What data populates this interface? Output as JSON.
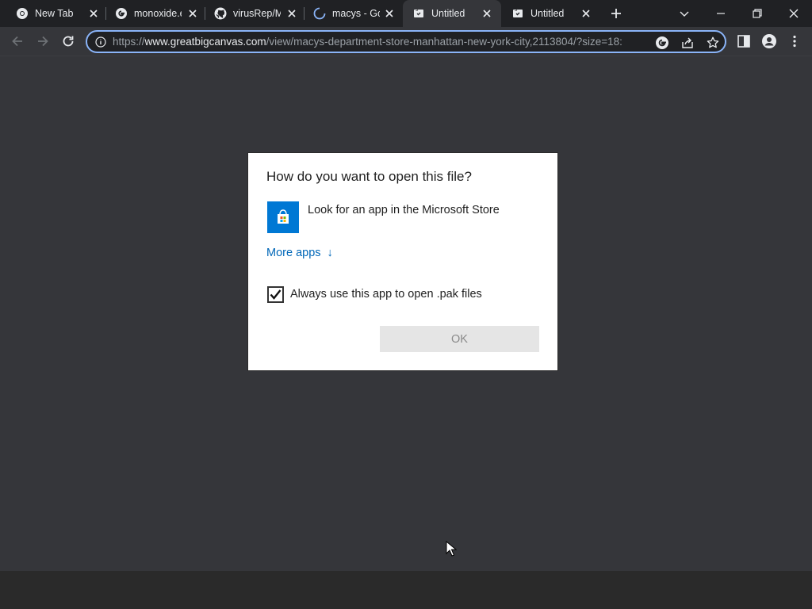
{
  "tabs": [
    {
      "title": "New Tab",
      "icon": "chrome-icon"
    },
    {
      "title": "monoxide.e",
      "icon": "google-icon"
    },
    {
      "title": "virusRep/M",
      "icon": "github-icon"
    },
    {
      "title": "macys - Go",
      "icon": "loading-spinner-icon"
    },
    {
      "title": "Untitled",
      "icon": "page-icon",
      "active": true
    },
    {
      "title": "Untitled",
      "icon": "page-icon"
    }
  ],
  "omnibox": {
    "scheme": "https://",
    "host": "www.greatbigcanvas.com",
    "path": "/view/macys-department-store-manhattan-new-york-city,2113804/?size=18:"
  },
  "dialog": {
    "title": "How do you want to open this file?",
    "store_option": "Look for an app in the Microsoft Store",
    "more_apps": "More apps",
    "more_apps_arrow": "↓",
    "always_use_label": "Always use this app to open .pak files",
    "always_use_checked": true,
    "ok_label": "OK"
  },
  "colors": {
    "accent_link": "#0067b8",
    "store_tile": "#0078d4",
    "omnibox_focus": "#8ab4f8",
    "chrome_dark": "#202124",
    "page_bg": "#35363a"
  }
}
